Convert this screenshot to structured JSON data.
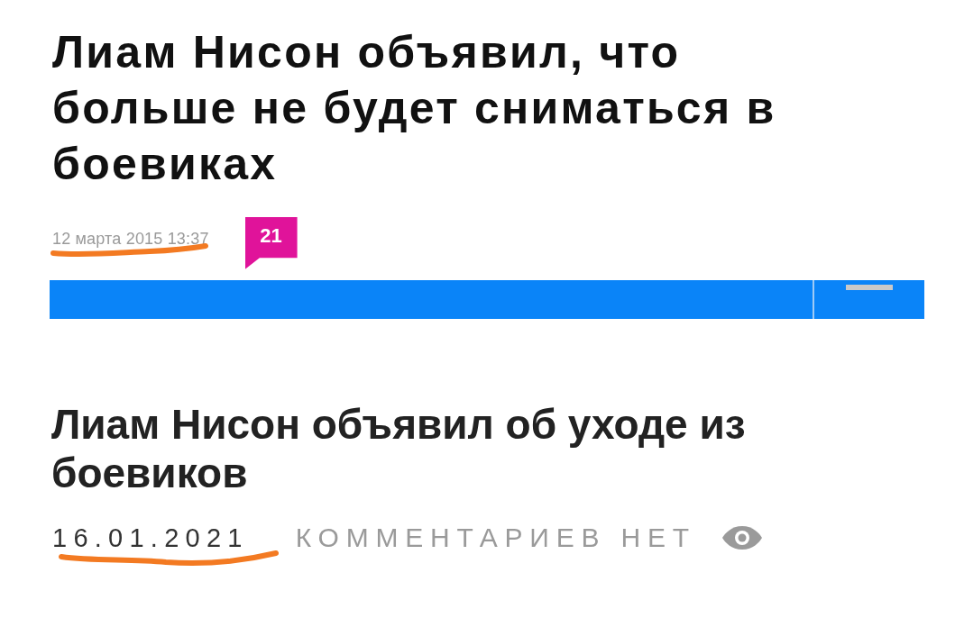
{
  "article_old": {
    "headline": "Лиам Нисон объявил, что больше не будет сниматься в боевиках",
    "date": "12 марта 2015 13:37",
    "comment_count": "21"
  },
  "article_new": {
    "headline": "Лиам Нисон объявил об уходе из боевиков",
    "date": "16.01.2021",
    "comments": "КОММЕНТАРИЕВ НЕТ"
  }
}
